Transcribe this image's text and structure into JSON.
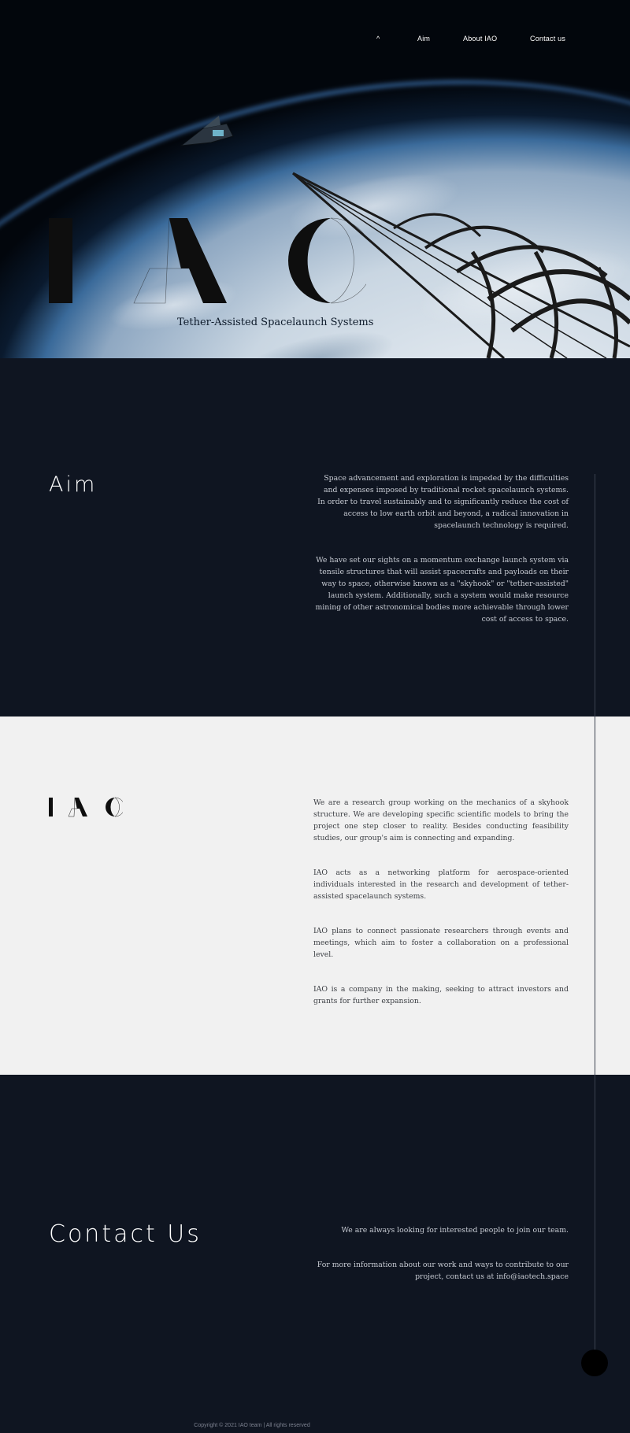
{
  "nav": {
    "home_symbol": "^",
    "aim": "Aim",
    "about": "About IAO",
    "contact": "Contact us"
  },
  "hero": {
    "logo_text": "IAO",
    "tagline": "Tether-Assisted Spacelaunch Systems"
  },
  "aim": {
    "title": "Aim",
    "paragraphs": [
      "Space advancement and exploration is impeded by the difficulties and expenses imposed by traditional rocket spacelaunch systems. In order to travel sustainably and to significantly reduce the cost of access to low earth orbit and beyond, a radical innovation in spacelaunch technology is required.",
      "We have set our sights on a momentum exchange launch system via tensile structures that will assist spacecrafts and payloads on their way to space, otherwise known as a \"skyhook\" or \"tether-assisted\" launch system. Additionally, such a system would make resource mining of other astronomical bodies more achievable through lower cost of access to space."
    ]
  },
  "about": {
    "logo_text": "IAO",
    "paragraphs": [
      "We are a research group working on the mechanics of a skyhook structure. We are developing specific scientific models to bring the project one step closer to reality. Besides conducting feasibility studies, our group's aim is connecting and expanding.",
      "IAO acts as a networking platform for aerospace-oriented individuals interested in the research and development of tether-assisted spacelaunch systems.",
      "IAO plans to connect passionate researchers through events and meetings, which aim to foster a collaboration on a professional level.",
      "IAO is a company in the making, seeking to attract investors and grants for further expansion."
    ]
  },
  "contact": {
    "title": "Contact Us",
    "line1": "We are always looking for interested people to join our team.",
    "line2": "For more information about our work and ways to contribute to our project, contact us at info@iaotech.space"
  },
  "footer": {
    "copyright": "Copyright © 2021 IAO team | All rights reserved"
  },
  "colors": {
    "dark_bg": "#0f1521",
    "light_bg": "#f1f1f1",
    "text_light": "#c8ccd4",
    "text_dark": "#3c3f44"
  }
}
